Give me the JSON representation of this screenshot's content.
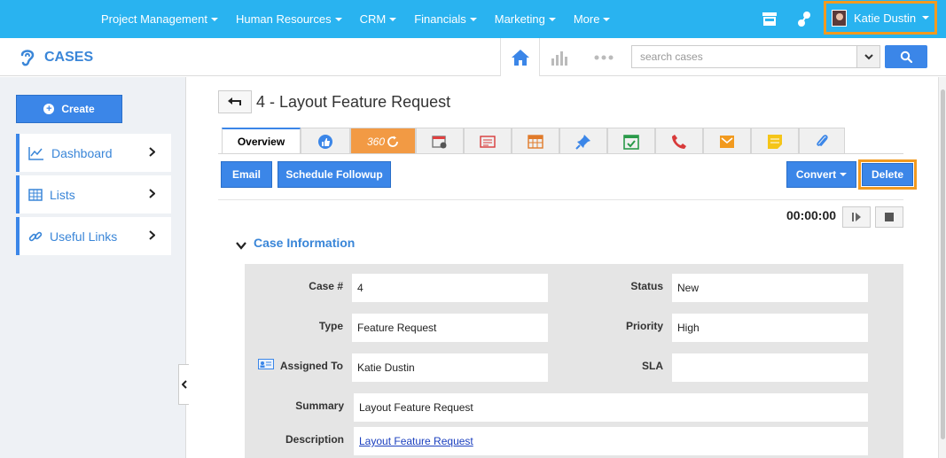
{
  "topnav": {
    "menu": [
      {
        "label": "Project Management"
      },
      {
        "label": "Human Resources"
      },
      {
        "label": "CRM"
      },
      {
        "label": "Financials"
      },
      {
        "label": "Marketing"
      },
      {
        "label": "More"
      }
    ],
    "user_name": "Katie Dustin"
  },
  "module": {
    "title": "CASES",
    "search_placeholder": "search cases"
  },
  "sidebar": {
    "create_label": "Create",
    "items": [
      {
        "label": "Dashboard"
      },
      {
        "label": "Lists"
      },
      {
        "label": "Useful Links"
      }
    ]
  },
  "record": {
    "title": "4 - Layout Feature Request"
  },
  "tabs": {
    "overview_label": "Overview",
    "three60_label": "360"
  },
  "actions": {
    "email_label": "Email",
    "followup_label": "Schedule Followup",
    "convert_label": "Convert",
    "delete_label": "Delete"
  },
  "timer": "00:00:00",
  "section": {
    "title": "Case Information",
    "fields": {
      "case_no_label": "Case #",
      "case_no": "4",
      "status_label": "Status",
      "status": "New",
      "type_label": "Type",
      "type": "Feature Request",
      "priority_label": "Priority",
      "priority": "High",
      "assigned_label": "Assigned To",
      "assigned": "Katie Dustin",
      "sla_label": "SLA",
      "sla": "",
      "summary_label": "Summary",
      "summary": "Layout Feature Request",
      "description_label": "Description",
      "description": "Layout Feature Request"
    }
  },
  "colors": {
    "topbar": "#29b3f0",
    "accent": "#3b86e8",
    "highlight": "#f29a1f",
    "tab_360": "#f29a44"
  }
}
